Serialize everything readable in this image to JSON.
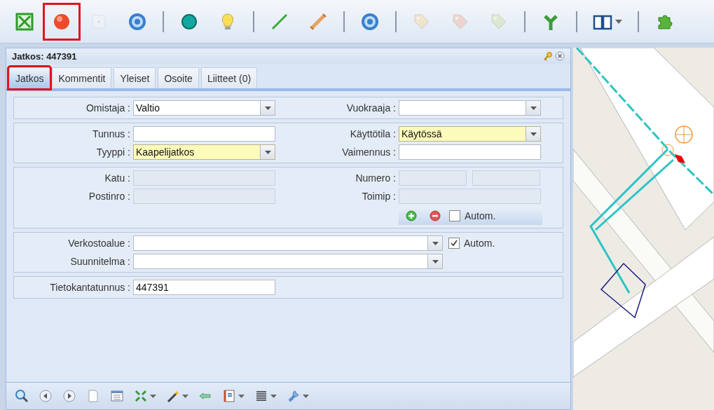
{
  "toolbar": [
    {
      "kind": "button",
      "disabled": false,
      "highlighted": false,
      "dropdown": false
    },
    {
      "kind": "button",
      "disabled": false,
      "highlighted": true,
      "dropdown": false
    },
    {
      "kind": "button",
      "disabled": true,
      "highlighted": false,
      "dropdown": false
    },
    {
      "kind": "button",
      "disabled": false,
      "highlighted": false,
      "dropdown": false
    },
    {
      "kind": "separator"
    },
    {
      "kind": "button",
      "disabled": false,
      "highlighted": false,
      "dropdown": false
    },
    {
      "kind": "button",
      "disabled": false,
      "highlighted": false,
      "dropdown": false
    },
    {
      "kind": "separator"
    },
    {
      "kind": "button",
      "disabled": false,
      "highlighted": false,
      "dropdown": false
    },
    {
      "kind": "button",
      "disabled": false,
      "highlighted": false,
      "dropdown": false
    },
    {
      "kind": "separator"
    },
    {
      "kind": "button",
      "disabled": false,
      "highlighted": false,
      "dropdown": false
    },
    {
      "kind": "separator"
    },
    {
      "kind": "button",
      "disabled": true,
      "highlighted": false,
      "dropdown": false
    },
    {
      "kind": "button",
      "disabled": true,
      "highlighted": false,
      "dropdown": false
    },
    {
      "kind": "button",
      "disabled": true,
      "highlighted": false,
      "dropdown": false
    },
    {
      "kind": "separator"
    },
    {
      "kind": "button",
      "disabled": false,
      "highlighted": false,
      "dropdown": false
    },
    {
      "kind": "separator"
    },
    {
      "kind": "button",
      "disabled": false,
      "highlighted": false,
      "dropdown": true
    },
    {
      "kind": "separator"
    },
    {
      "kind": "button",
      "disabled": false,
      "highlighted": false,
      "dropdown": false
    }
  ],
  "panel": {
    "title": "Jatkos: 447391",
    "tabs": [
      {
        "label": "Jatkos",
        "selected": true,
        "highlighted": true
      },
      {
        "label": "Kommentit",
        "selected": false,
        "highlighted": false
      },
      {
        "label": "Yleiset",
        "selected": false,
        "highlighted": false
      },
      {
        "label": "Osoite",
        "selected": false,
        "highlighted": false
      },
      {
        "label": "Liitteet (0)",
        "selected": false,
        "highlighted": false
      }
    ],
    "sections": [
      {
        "rows": [
          [
            {
              "kind": "combo",
              "label": "Omistaja :",
              "value": "Valtio",
              "required": false,
              "disabled": false
            },
            {
              "kind": "combo",
              "label": "Vuokraaja :",
              "required": false,
              "disabled": false
            }
          ]
        ]
      },
      {
        "rows": [
          [
            {
              "kind": "text",
              "label": "Tunnus :",
              "required": false,
              "disabled": false
            },
            {
              "kind": "combo",
              "label": "Käyttötila :",
              "value": "Käytössä",
              "required": true,
              "disabled": false
            }
          ],
          [
            {
              "kind": "combo",
              "label": "Tyyppi :",
              "value": "Kaapelijatkos",
              "required": true,
              "disabled": false
            },
            {
              "kind": "text",
              "label": "Vaimennus :",
              "required": false,
              "disabled": false
            }
          ]
        ]
      },
      {
        "rows": [
          [
            {
              "kind": "text",
              "label": "Katu :",
              "required": false,
              "disabled": true
            },
            {
              "kind": "split",
              "label": "Numero :",
              "required": false,
              "disabled": true
            }
          ],
          [
            {
              "kind": "text",
              "label": "Postinro :",
              "required": false,
              "disabled": true
            },
            {
              "kind": "text",
              "label": "Toimip :",
              "required": false,
              "disabled": true
            }
          ]
        ],
        "actions": {
          "checkbox": {
            "label": "Autom.",
            "checked": false
          }
        }
      },
      {
        "rows": [
          [
            {
              "kind": "wide-combo",
              "label": "Verkostoalue :",
              "required": false,
              "disabled": false
            },
            {
              "kind": "checkbox",
              "label": "Autom.",
              "checked": true
            }
          ],
          [
            {
              "kind": "wide-combo",
              "label": "Suunnitelma :",
              "required": false,
              "disabled": false
            }
          ]
        ]
      },
      {
        "rows": [
          [
            {
              "kind": "text",
              "label": "Tietokantatunnus :",
              "value": "447391",
              "required": false,
              "disabled": false
            }
          ]
        ]
      }
    ]
  },
  "bottom_toolbar": [
    {
      "dropdown": false
    },
    {
      "dropdown": false
    },
    {
      "dropdown": false
    },
    {
      "dropdown": false
    },
    {
      "dropdown": false
    },
    {
      "dropdown": true
    },
    {
      "dropdown": true
    },
    {
      "dropdown": false
    },
    {
      "dropdown": true
    },
    {
      "dropdown": true
    },
    {
      "dropdown": true
    }
  ]
}
